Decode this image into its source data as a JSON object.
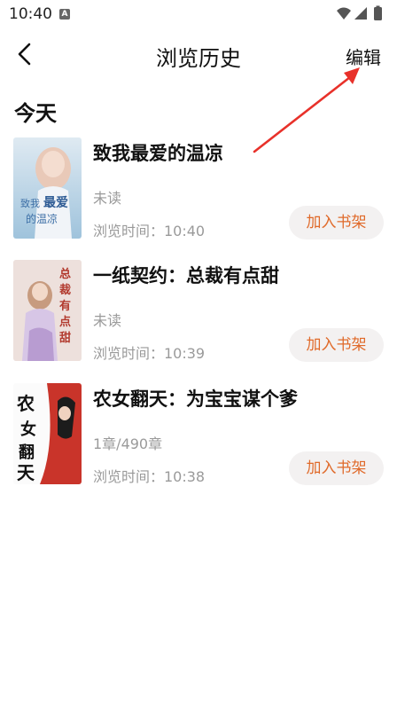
{
  "status_bar": {
    "time": "10:40",
    "notification_icon": "font-a-icon",
    "icons": [
      "wifi-icon",
      "signal-icon",
      "battery-icon"
    ]
  },
  "header": {
    "title": "浏览历史",
    "edit_label": "编辑",
    "back_icon": "back-chevron-icon"
  },
  "section": {
    "label": "今天"
  },
  "books": [
    {
      "title": "致我最爱的温凉",
      "progress": "未读",
      "browse_time": "浏览时间：10:40",
      "button": "加入书架",
      "cover_text": "致我最爱的温凉"
    },
    {
      "title": "一纸契约：总裁有点甜",
      "progress": "未读",
      "browse_time": "浏览时间：10:39",
      "button": "加入书架",
      "cover_text": "总裁有点甜"
    },
    {
      "title": "农女翻天：为宝宝谋个爹",
      "progress": "1章/490章",
      "browse_time": "浏览时间：10:38",
      "button": "加入书架",
      "cover_text": "农女翻天"
    }
  ],
  "colors": {
    "accent": "#e06a2a",
    "muted": "#9a9a9a",
    "button_bg": "#f3f1f1",
    "annotation": "#e8312a"
  }
}
